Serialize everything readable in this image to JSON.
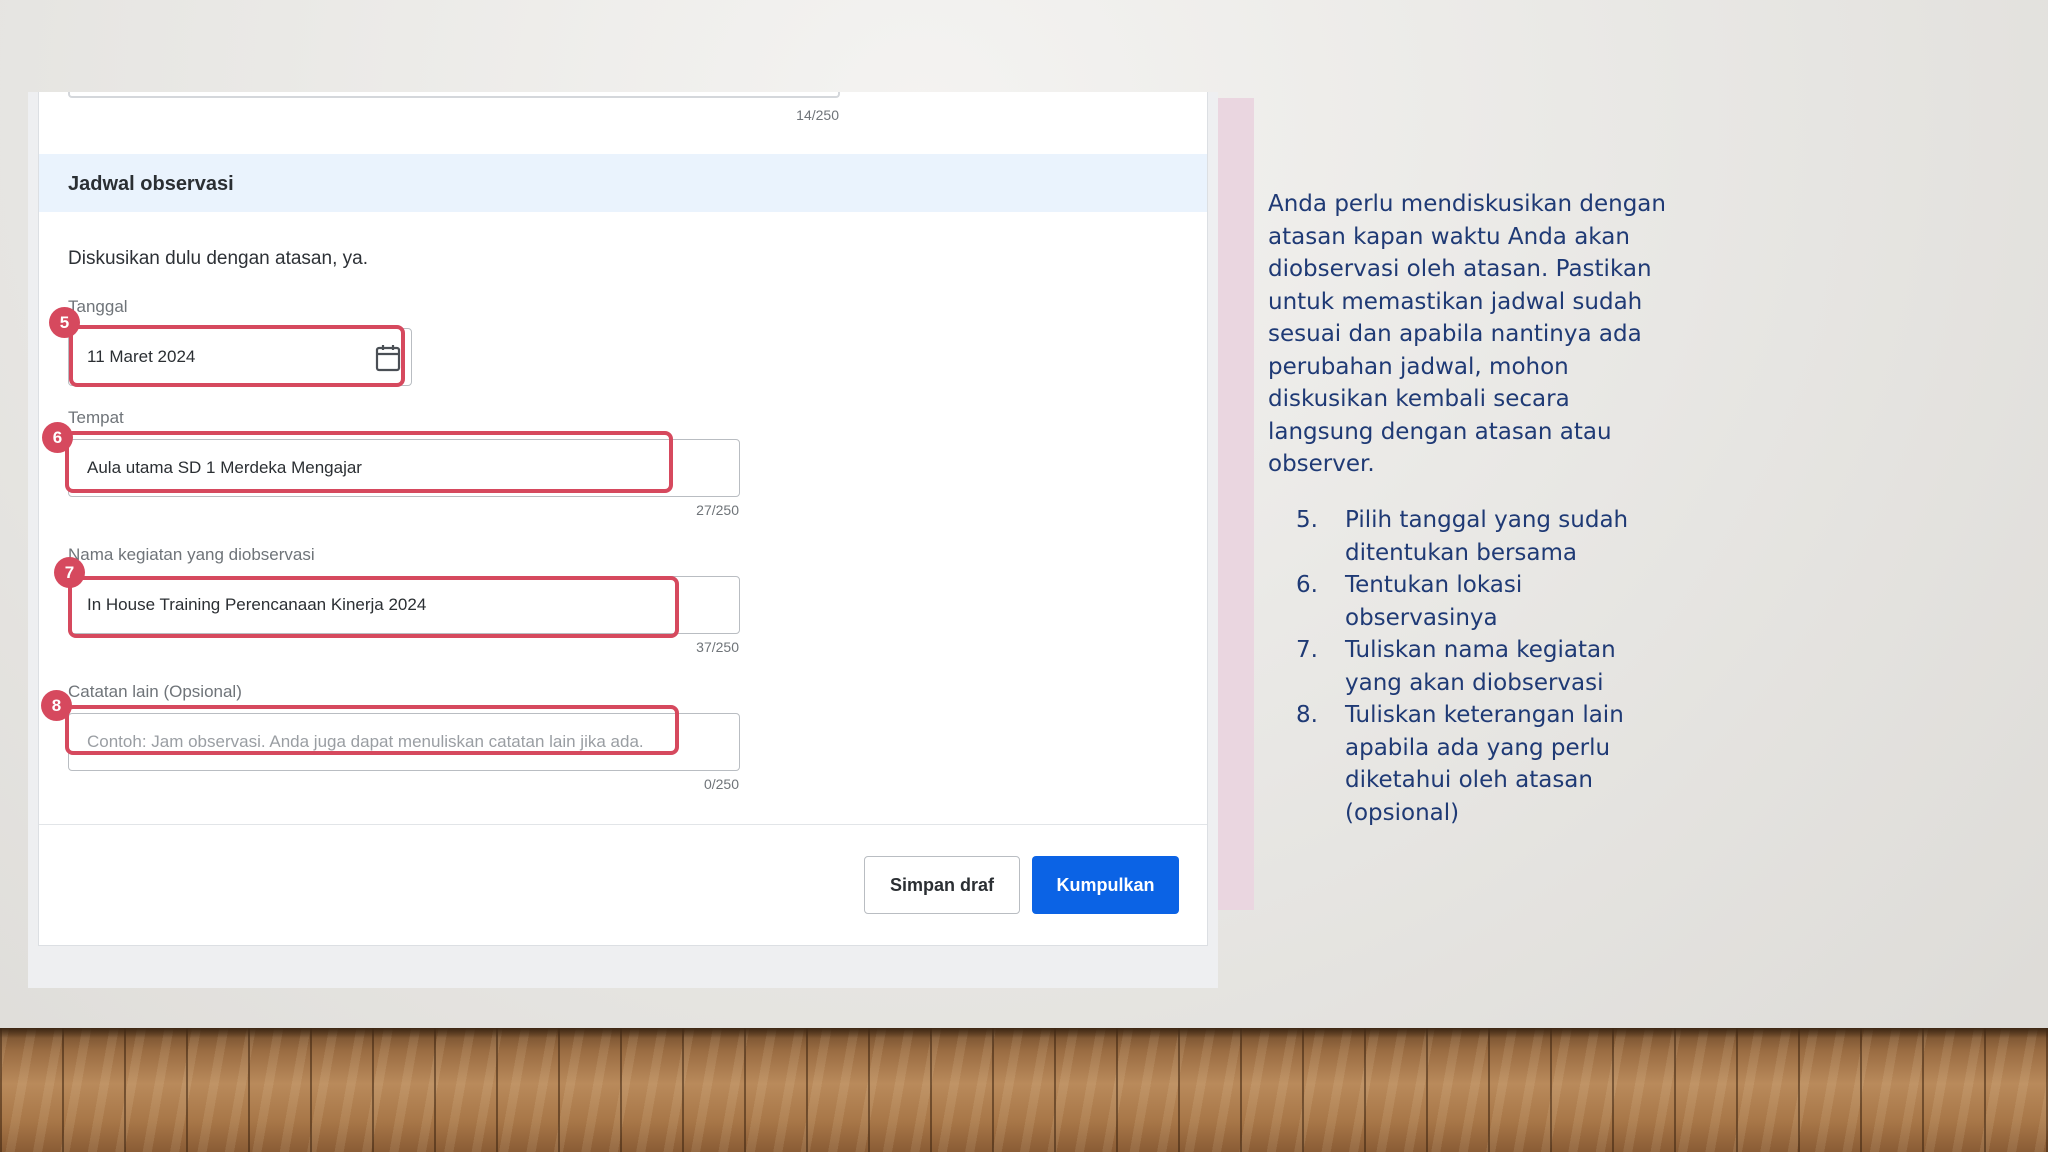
{
  "form": {
    "prev_counter": "14/250",
    "section_title": "Jadwal observasi",
    "description": "Diskusikan dulu dengan atasan, ya.",
    "date": {
      "label": "Tanggal",
      "value": "11 Maret 2024",
      "badge": "5"
    },
    "place": {
      "label": "Tempat",
      "value": "Aula utama SD 1 Merdeka Mengajar",
      "counter": "27/250",
      "badge": "6"
    },
    "activity": {
      "label": "Nama kegiatan yang diobservasi",
      "value": "In House Training Perencanaan Kinerja 2024",
      "counter": "37/250",
      "badge": "7"
    },
    "notes": {
      "label": "Catatan lain (Opsional)",
      "placeholder": "Contoh: Jam observasi. Anda juga dapat menuliskan catatan lain jika ada.",
      "counter": "0/250",
      "badge": "8"
    },
    "buttons": {
      "draft": "Simpan draf",
      "submit": "Kumpulkan"
    }
  },
  "explanation": {
    "paragraph": "Anda perlu mendiskusikan dengan atasan kapan waktu Anda akan diobservasi oleh atasan. Pastikan untuk memastikan jadwal sudah sesuai dan apabila nantinya ada perubahan jadwal, mohon diskusikan kembali secara langsung dengan atasan atau observer.",
    "steps": [
      {
        "num": "5.",
        "text": "Pilih tanggal yang sudah ditentukan bersama"
      },
      {
        "num": "6.",
        "text": "Tentukan lokasi observasinya"
      },
      {
        "num": "7.",
        "text": "Tuliskan nama kegiatan yang akan diobservasi"
      },
      {
        "num": "8.",
        "text": "Tuliskan keterangan lain apabila ada yang perlu diketahui oleh atasan (opsional)"
      }
    ]
  },
  "colors": {
    "highlight": "#d6495e",
    "submit_button": "#0b63e5",
    "section_header_bg": "#eaf3fd",
    "explanation_text": "#1f3a75",
    "pink_accent": "#ead6e0"
  },
  "icons": {
    "date_picker": "calendar-icon"
  }
}
